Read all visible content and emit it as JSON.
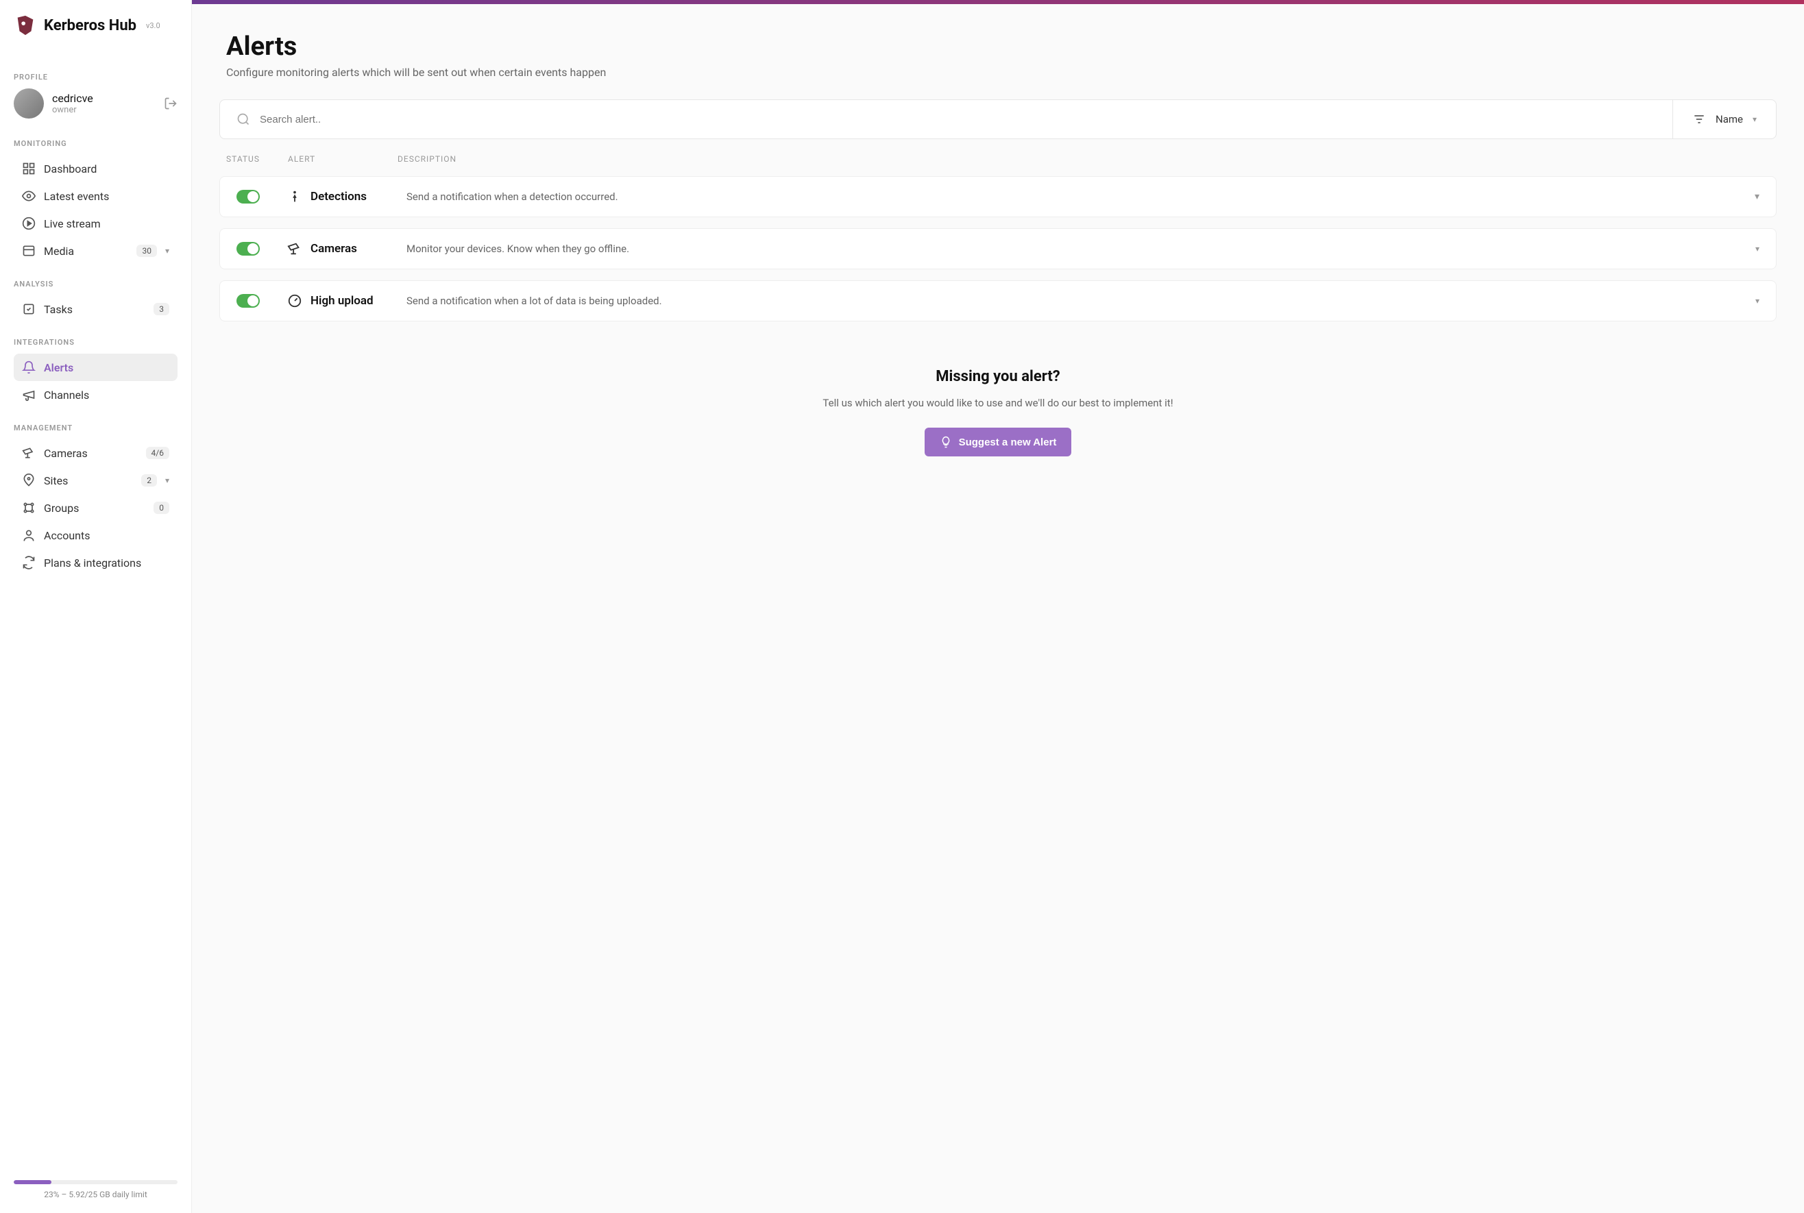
{
  "brand": {
    "name": "Kerberos Hub",
    "version": "v3.0"
  },
  "sections": {
    "profile": "PROFILE",
    "monitoring": "MONITORING",
    "analysis": "ANALYSIS",
    "integrations": "INTEGRATIONS",
    "management": "MANAGEMENT"
  },
  "profile": {
    "name": "cedricve",
    "role": "owner"
  },
  "nav": {
    "dashboard": "Dashboard",
    "latest_events": "Latest events",
    "live_stream": "Live stream",
    "media": "Media",
    "media_badge": "30",
    "tasks": "Tasks",
    "tasks_badge": "3",
    "alerts": "Alerts",
    "channels": "Channels",
    "cameras": "Cameras",
    "cameras_badge": "4/6",
    "sites": "Sites",
    "sites_badge": "2",
    "groups": "Groups",
    "groups_badge": "0",
    "accounts": "Accounts",
    "plans": "Plans & integrations"
  },
  "usage": {
    "percent": 23,
    "text": "23% – 5.92/25 GB daily limit"
  },
  "page": {
    "title": "Alerts",
    "subtitle": "Configure monitoring alerts which will be sent out when certain events happen"
  },
  "search": {
    "placeholder": "Search alert.."
  },
  "sort": {
    "label": "Name"
  },
  "columns": {
    "status": "STATUS",
    "alert": "ALERT",
    "description": "DESCRIPTION"
  },
  "alerts_list": [
    {
      "name": "Detections",
      "description": "Send a notification when a detection occurred.",
      "enabled": true,
      "icon": "person-icon"
    },
    {
      "name": "Cameras",
      "description": "Monitor your devices. Know when they go offline.",
      "enabled": true,
      "icon": "camera-icon"
    },
    {
      "name": "High upload",
      "description": "Send a notification when a lot of data is being uploaded.",
      "enabled": true,
      "icon": "gauge-icon"
    }
  ],
  "cta": {
    "title": "Missing you alert?",
    "text": "Tell us which alert you would like to use and we'll do our best to implement it!",
    "button": "Suggest a new Alert"
  },
  "colors": {
    "accent": "#8B5FBF",
    "success": "#4CAF50"
  }
}
